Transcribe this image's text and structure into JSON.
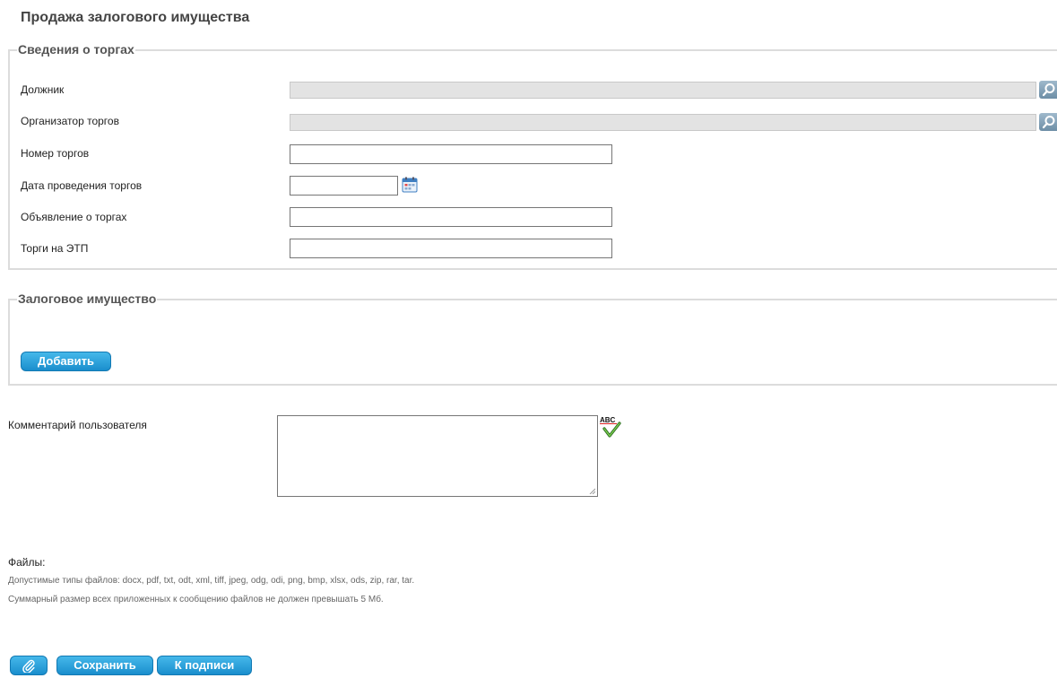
{
  "page_title": "Продажа залогового имущества",
  "auction_section": {
    "legend": "Сведения о торгах",
    "fields": {
      "debtor": {
        "label": "Должник",
        "value": ""
      },
      "organizer": {
        "label": "Организатор торгов",
        "value": ""
      },
      "auction_number": {
        "label": "Номер торгов",
        "value": ""
      },
      "auction_date": {
        "label": "Дата проведения торгов",
        "value": ""
      },
      "announcement": {
        "label": "Объявление о торгах",
        "value": ""
      },
      "etp": {
        "label": "Торги на ЭТП",
        "value": ""
      }
    }
  },
  "pledge_section": {
    "legend": "Залоговое имущество",
    "add_button": "Добавить"
  },
  "comment": {
    "label": "Комментарий пользователя",
    "value": "",
    "spellcheck_icon_text": "ABC"
  },
  "files": {
    "title": "Файлы:",
    "allowed_types": "Допустимые типы файлов: docx, pdf, txt, odt, xml, tiff, jpeg, odg, odi, png, bmp, xlsx, ods, zip, rar, tar.",
    "size_limit": "Суммарный размер всех приложенных к сообщению файлов не должен превышать 5 Мб."
  },
  "actions": {
    "save": "Сохранить",
    "to_sign": "К подписи"
  },
  "colors": {
    "button_blue": "#1a8ecd",
    "readonly_bg": "#e3e3e3",
    "border_gray": "#dcdcdc"
  },
  "icons": [
    "search-icon",
    "calendar-icon",
    "spellcheck-icon",
    "paperclip-icon"
  ]
}
